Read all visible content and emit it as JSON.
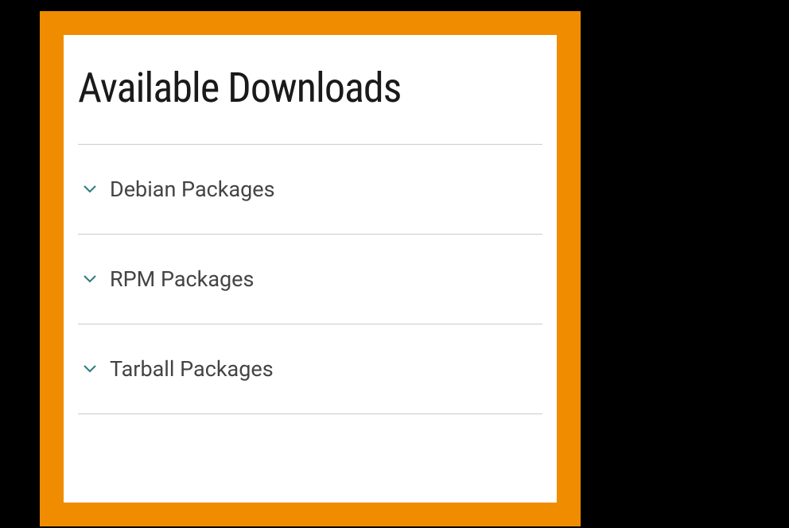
{
  "section": {
    "title": "Available Downloads"
  },
  "downloads": {
    "items": [
      {
        "label": "Debian Packages"
      },
      {
        "label": "RPM Packages"
      },
      {
        "label": "Tarball Packages"
      }
    ]
  }
}
